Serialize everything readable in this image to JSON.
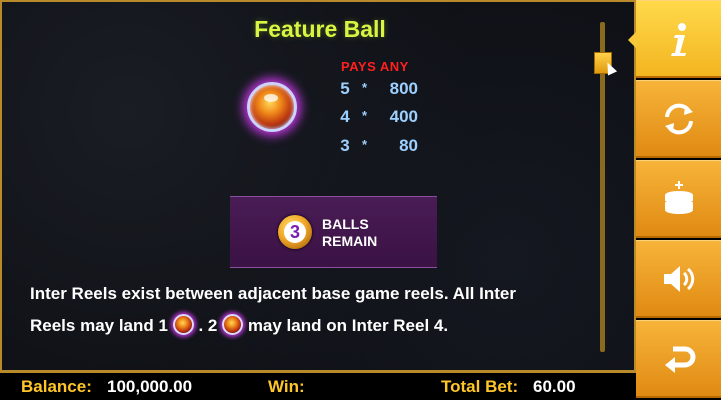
{
  "paytable": {
    "title": "Feature Ball",
    "pays_header": "PAYS ANY",
    "pays": [
      {
        "count": "5",
        "star": "*",
        "amount": "800"
      },
      {
        "count": "4",
        "star": "*",
        "amount": "400"
      },
      {
        "count": "3",
        "star": "*",
        "amount": "80"
      }
    ],
    "remain": {
      "count": "3",
      "line1": "BALLS",
      "line2": "REMAIN"
    },
    "description": {
      "line1": "Inter Reels exist between adjacent base game reels. All Inter",
      "line2_a": "Reels may land 1",
      "line2_b": ". 2",
      "line2_c": "may land on Inter Reel 4."
    }
  },
  "sidebar": {
    "buttons": [
      {
        "name": "info",
        "icon": "info-icon"
      },
      {
        "name": "autoplay",
        "icon": "refresh-icon"
      },
      {
        "name": "bet",
        "icon": "coin-stack-icon"
      },
      {
        "name": "sound",
        "icon": "speaker-icon"
      },
      {
        "name": "back",
        "icon": "return-arrow-icon"
      }
    ]
  },
  "status_bar": {
    "balance_label": "Balance:",
    "balance_value": "100,000.00",
    "win_label": "Win:",
    "win_value": "",
    "total_bet_label": "Total Bet:",
    "total_bet_value": "60.00"
  },
  "colors": {
    "title": "#d8f542",
    "pays_header": "#ff1f1f",
    "pay_values": "#9dd0ff",
    "status_label": "#ffc629",
    "sidebar": "#f0a020",
    "frame": "#b88a2a"
  }
}
